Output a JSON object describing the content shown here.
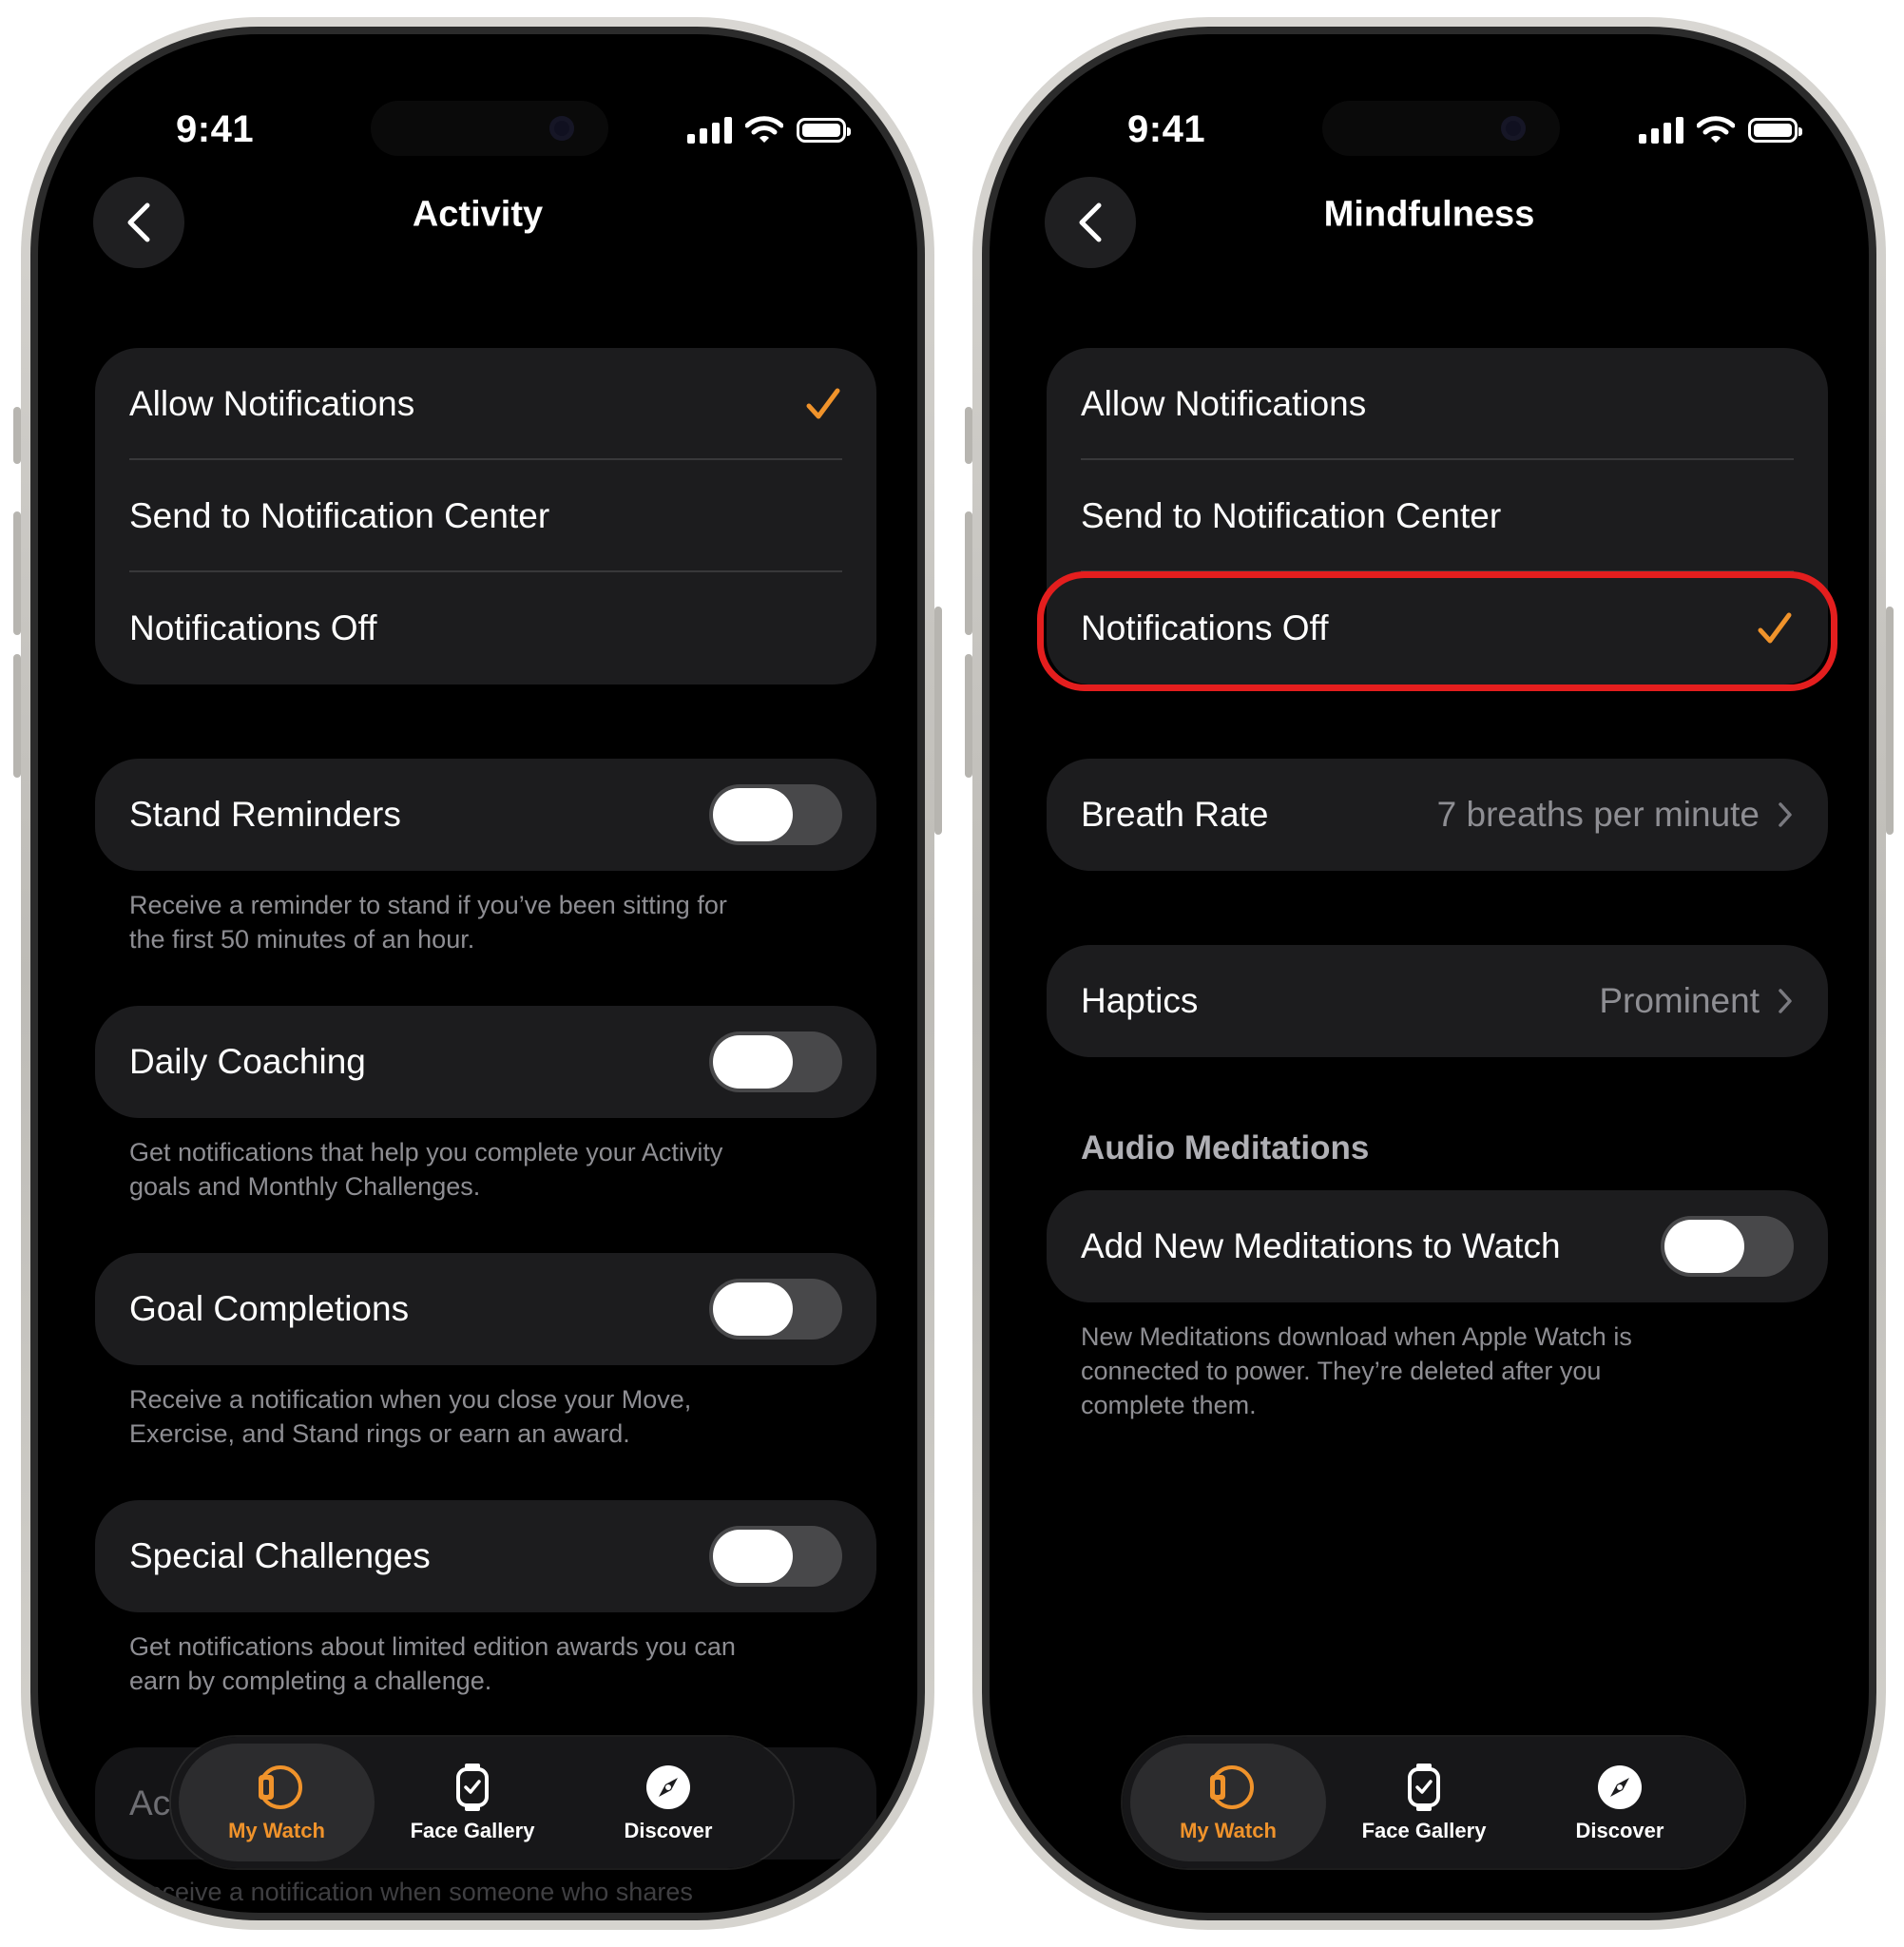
{
  "status_bar": {
    "time": "9:41"
  },
  "left": {
    "title": "Activity",
    "notification_options": [
      {
        "label": "Allow Notifications",
        "checked": true
      },
      {
        "label": "Send to Notification Center",
        "checked": false
      },
      {
        "label": "Notifications Off",
        "checked": false
      }
    ],
    "toggles": [
      {
        "label": "Stand Reminders",
        "on": false,
        "footer_line1": "Receive a reminder to stand if you’ve been sitting for",
        "footer_line2": "the first 50 minutes of an hour."
      },
      {
        "label": "Daily Coaching",
        "on": false,
        "footer_line1": "Get notifications that help you complete your Activity",
        "footer_line2": "goals and Monthly Challenges."
      },
      {
        "label": "Goal Completions",
        "on": false,
        "footer_line1": "Receive a notification when you close your Move,",
        "footer_line2": "Exercise, and Stand rings or earn an award."
      },
      {
        "label": "Special Challenges",
        "on": false,
        "footer_line1": "Get notifications about limited edition awards you can",
        "footer_line2": "earn by completing a challenge."
      }
    ],
    "partial_row_label": "Ac",
    "partial_footer": "Receive a notification when someone who shares"
  },
  "right": {
    "title": "Mindfulness",
    "notification_options": [
      {
        "label": "Allow Notifications",
        "checked": false
      },
      {
        "label": "Send to Notification Center",
        "checked": false
      },
      {
        "label": "Notifications Off",
        "checked": true
      }
    ],
    "breath_rate": {
      "label": "Breath Rate",
      "value": "7 breaths per minute"
    },
    "haptics": {
      "label": "Haptics",
      "value": "Prominent"
    },
    "audio_section": "Audio Meditations",
    "add_meditations": {
      "label": "Add New Meditations to Watch",
      "on": false,
      "footer_line1": "New Meditations download when Apple Watch is",
      "footer_line2": "connected to power. They’re deleted after you",
      "footer_line3": "complete them."
    }
  },
  "tabs": [
    {
      "label": "My Watch",
      "icon": "my-watch-icon",
      "active": true
    },
    {
      "label": "Face Gallery",
      "icon": "face-gallery-icon",
      "active": false
    },
    {
      "label": "Discover",
      "icon": "compass-icon",
      "active": false
    }
  ],
  "colors": {
    "accent": "#f0932b",
    "highlight": "#e41e1e",
    "group_bg": "#1c1c1e"
  }
}
